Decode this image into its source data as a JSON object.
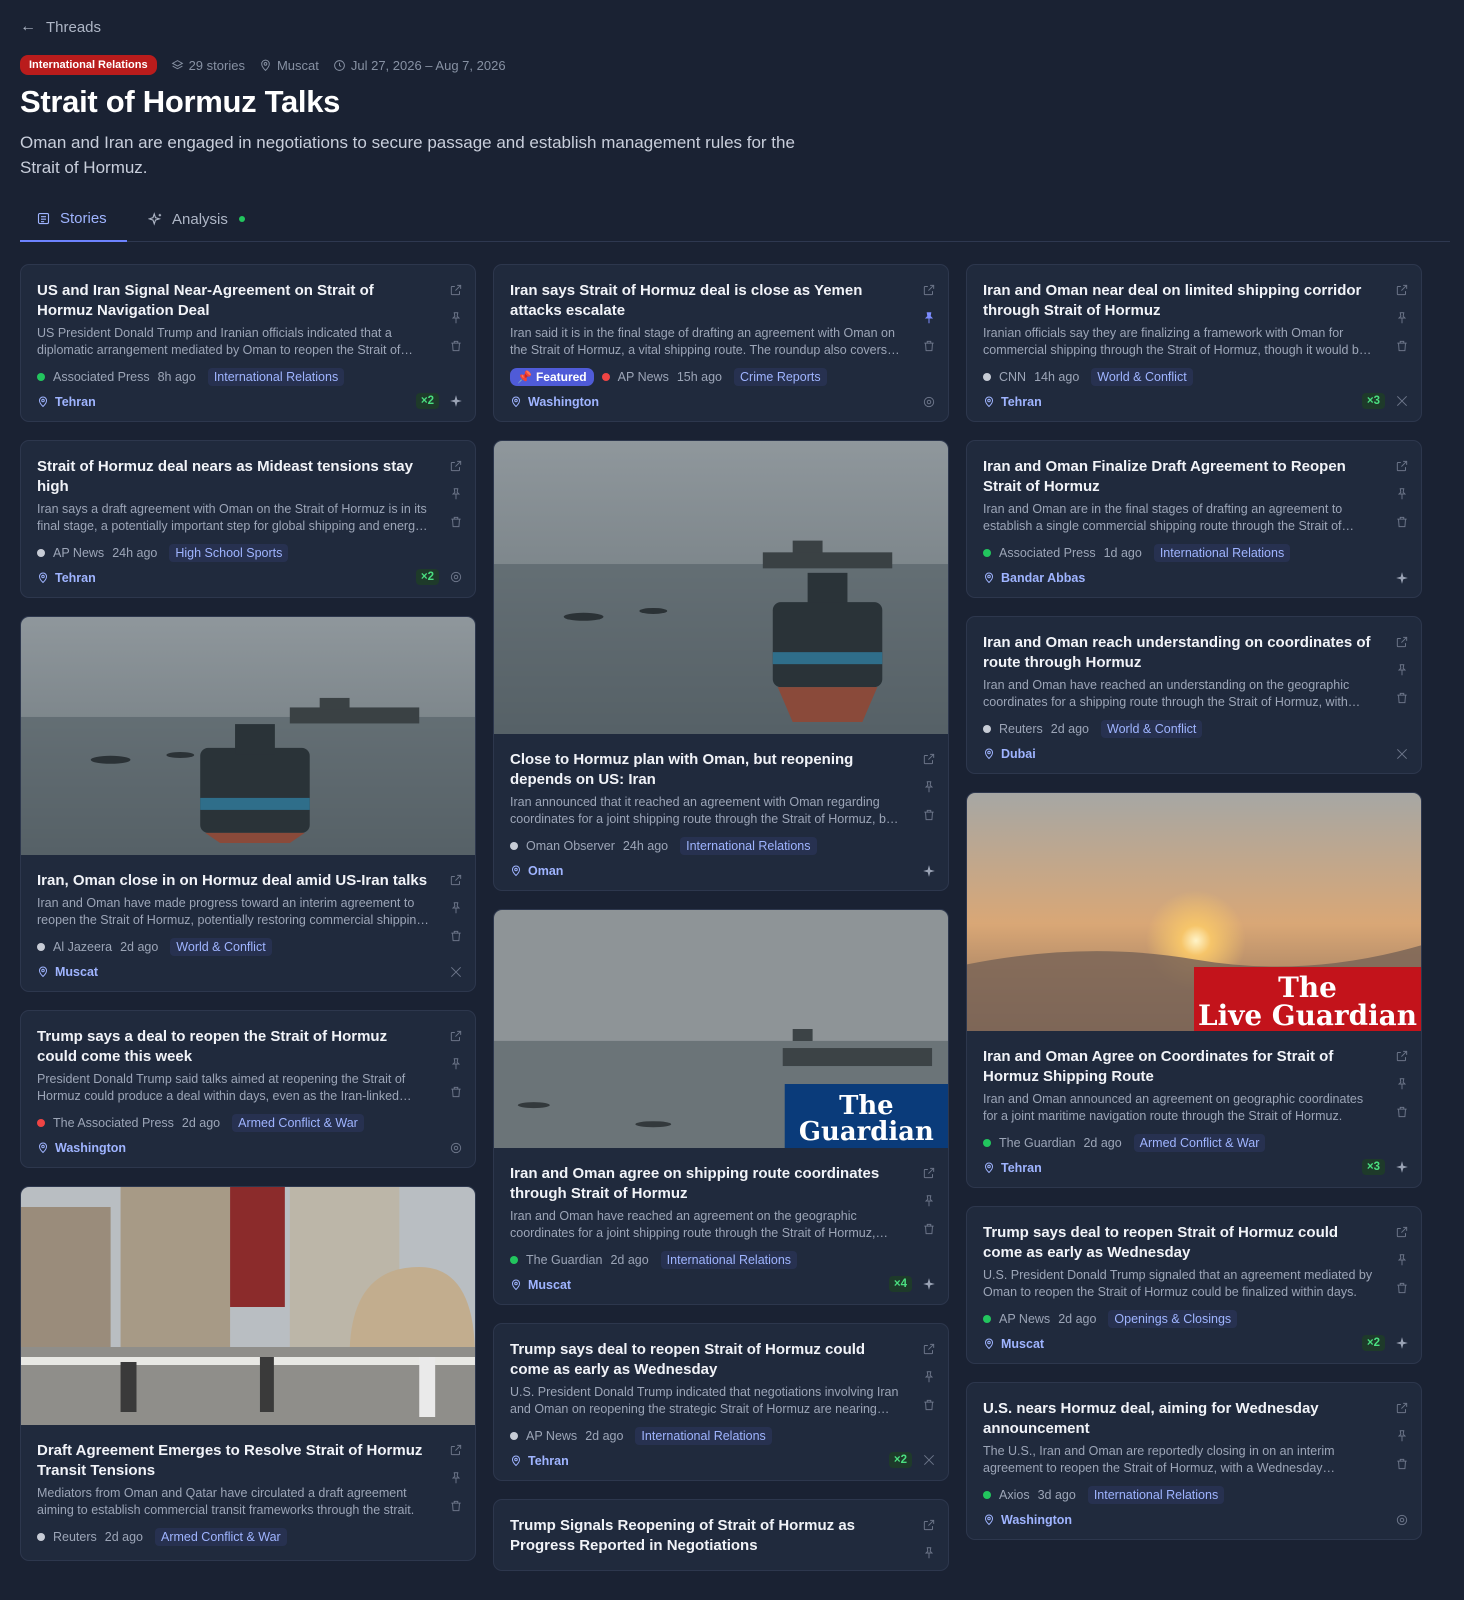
{
  "nav": {
    "back_label": "Threads"
  },
  "thread": {
    "category": "International Relations",
    "stories_count": "29 stories",
    "location": "Muscat",
    "date_range": "Jul 27, 2026 – Aug 7, 2026",
    "title": "Strait of Hormuz Talks",
    "description": "Oman and Iran are engaged in negotiations to secure passage and establish management rules for the Strait of Hormuz."
  },
  "tabs": {
    "stories": "Stories",
    "analysis": "Analysis"
  },
  "colors": {
    "accent": "#6d83ff",
    "category_badge": "#b91c1c",
    "dot_green": "#22c55e",
    "dot_red": "#ef4444",
    "dot_gray": "#c7ccd6"
  },
  "columns": [
    [
      {
        "title": "US and Iran Signal Near-Agreement on Strait of Hormuz Navigation Deal",
        "summary": "US President Donald Trump and Iranian officials indicated that a diplomatic arrangement mediated by Oman to reopen the Strait of Hormuz could be finalized soon.",
        "source": "Associated Press",
        "dot": "green",
        "time": "8h ago",
        "category": "International Relations",
        "location": "Tehran",
        "dup": "×2",
        "foot_icon": "sparkle"
      },
      {
        "title": "Strait of Hormuz deal nears as Mideast tensions stay high",
        "summary": "Iran says a draft agreement with Oman on the Strait of Hormuz is in its final stage, a potentially important step for global shipping and energy markets.",
        "source": "AP News",
        "dot": "gray",
        "time": "24h ago",
        "category": "High School Sports",
        "location": "Tehran",
        "dup": "×2",
        "foot_icon": "gear"
      },
      {
        "image": "boat",
        "title": "Iran, Oman close in on Hormuz deal amid US-Iran talks",
        "summary": "Iran and Oman have made progress toward an interim agreement to reopen the Strait of Hormuz, potentially restoring commercial shipping traffic.",
        "source": "Al Jazeera",
        "dot": "gray",
        "time": "2d ago",
        "category": "World & Conflict",
        "location": "Muscat",
        "foot_icon": "x"
      },
      {
        "title": "Trump says a deal to reopen the Strait of Hormuz could come this week",
        "summary": "President Donald Trump said talks aimed at reopening the Strait of Hormuz could produce a deal within days, even as the Iran-linked attacks continue.",
        "source": "The Associated Press",
        "dot": "red",
        "time": "2d ago",
        "category": "Armed Conflict & War",
        "location": "Washington",
        "foot_icon": "gear"
      },
      {
        "image": "street",
        "title": "Draft Agreement Emerges to Resolve Strait of Hormuz Transit Tensions",
        "summary": "Mediators from Oman and Qatar have circulated a draft agreement aiming to establish commercial transit frameworks through the strait.",
        "source": "Reuters",
        "dot": "gray",
        "time": "2d ago",
        "category": "Armed Conflict & War",
        "location": ""
      }
    ],
    [
      {
        "title": "Iran says Strait of Hormuz deal is close as Yemen attacks escalate",
        "summary": "Iran said it is in the final stage of drafting an agreement with Oman on the Strait of Hormuz, a vital shipping route. The roundup also covers Yemen attacks.",
        "featured": "Featured",
        "pinned": true,
        "source": "AP News",
        "dot": "red",
        "time": "15h ago",
        "category": "Crime Reports",
        "location": "Washington",
        "foot_icon": "gear"
      },
      {
        "image": "boat2",
        "title": "Close to Hormuz plan with Oman, but reopening depends on US: Iran",
        "summary": "Iran announced that it reached an agreement with Oman regarding coordinates for a joint shipping route through the Strait of Hormuz, but reopening depends on Washington.",
        "source": "Oman Observer",
        "dot": "gray",
        "time": "24h ago",
        "category": "International Relations",
        "location": "Oman",
        "foot_icon": "sparkle"
      },
      {
        "image": "guardian",
        "image_label": "The Guardian",
        "title": "Iran and Oman agree on shipping route coordinates through Strait of Hormuz",
        "summary": "Iran and Oman have reached an agreement on the geographic coordinates for a joint shipping route through the Strait of Hormuz, officials said.",
        "source": "The Guardian",
        "dot": "green",
        "time": "2d ago",
        "category": "International Relations",
        "location": "Muscat",
        "dup": "×4",
        "foot_icon": "sparkle"
      },
      {
        "title": "Trump says deal to reopen Strait of Hormuz could come as early as Wednesday",
        "summary": "U.S. President Donald Trump indicated that negotiations involving Iran and Oman on reopening the strategic Strait of Hormuz are nearing completion.",
        "source": "AP News",
        "dot": "gray",
        "time": "2d ago",
        "category": "International Relations",
        "location": "Tehran",
        "dup": "×2",
        "foot_icon": "x"
      },
      {
        "title": "Trump Signals Reopening of Strait of Hormuz as Progress Reported in Negotiations",
        "summary": "",
        "source": "",
        "dot": "gray",
        "time": "",
        "category": "",
        "location": ""
      }
    ],
    [
      {
        "title": "Iran and Oman near deal on limited shipping corridor through Strait of Hormuz",
        "summary": "Iranian officials say they are finalizing a framework with Oman for commercial shipping through the Strait of Hormuz, though it would be limited in scope.",
        "source": "CNN",
        "dot": "gray",
        "time": "14h ago",
        "category": "World & Conflict",
        "location": "Tehran",
        "dup": "×3",
        "foot_icon": "x"
      },
      {
        "title": "Iran and Oman Finalize Draft Agreement to Reopen Strait of Hormuz",
        "summary": "Iran and Oman are in the final stages of drafting an agreement to establish a single commercial shipping route through the Strait of Hormuz.",
        "source": "Associated Press",
        "dot": "green",
        "time": "1d ago",
        "category": "International Relations",
        "location": "Bandar Abbas",
        "foot_icon": "sparkle"
      },
      {
        "title": "Iran and Oman reach understanding on coordinates of route through Hormuz",
        "summary": "Iran and Oman have reached an understanding on the geographic coordinates for a shipping route through the Strait of Hormuz, with details to follow.",
        "source": "Reuters",
        "dot": "gray",
        "time": "2d ago",
        "category": "World & Conflict",
        "location": "Dubai",
        "foot_icon": "x"
      },
      {
        "image": "sunset",
        "image_label": "The Live Guardian",
        "title": "Iran and Oman Agree on Coordinates for Strait of Hormuz Shipping Route",
        "summary": "Iran and Oman announced an agreement on geographic coordinates for a joint maritime navigation route through the Strait of Hormuz.",
        "source": "The Guardian",
        "dot": "green",
        "time": "2d ago",
        "category": "Armed Conflict & War",
        "location": "Tehran",
        "dup": "×3",
        "foot_icon": "sparkle"
      },
      {
        "title": "Trump says deal to reopen Strait of Hormuz could come as early as Wednesday",
        "summary": "U.S. President Donald Trump signaled that an agreement mediated by Oman to reopen the Strait of Hormuz could be finalized within days.",
        "source": "AP News",
        "dot": "green",
        "time": "2d ago",
        "category": "Openings & Closings",
        "location": "Muscat",
        "dup": "×2",
        "foot_icon": "sparkle"
      },
      {
        "title": "U.S. nears Hormuz deal, aiming for Wednesday announcement",
        "summary": "The U.S., Iran and Oman are reportedly closing in on an interim agreement to reopen the Strait of Hormuz, with a Wednesday announcement expected.",
        "source": "Axios",
        "dot": "green",
        "time": "3d ago",
        "category": "International Relations",
        "location": "Washington",
        "foot_icon": "gear"
      }
    ]
  ]
}
